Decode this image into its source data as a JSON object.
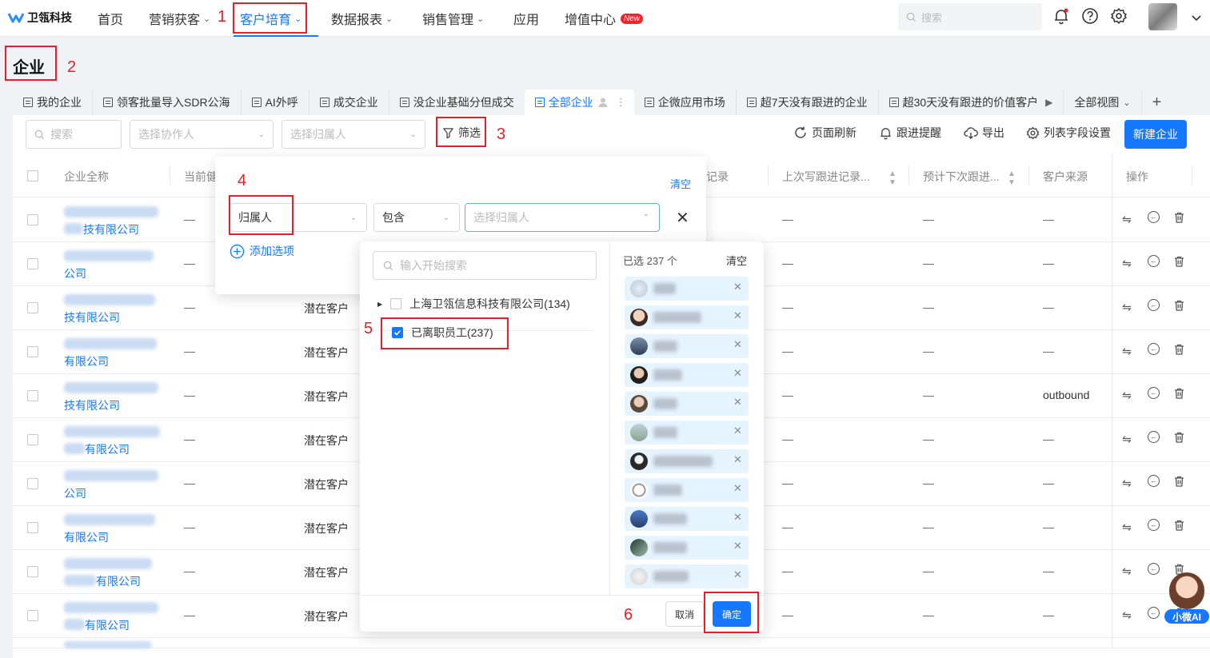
{
  "brand": {
    "name": "卫瓴科技"
  },
  "nav": {
    "items": [
      {
        "label": "首页"
      },
      {
        "label": "营销获客"
      },
      {
        "label": "客户培育"
      },
      {
        "label": "数据报表"
      },
      {
        "label": "销售管理"
      },
      {
        "label": "应用"
      },
      {
        "label": "增值中心"
      }
    ],
    "new_badge": "New",
    "search_placeholder": "搜索"
  },
  "annotations": {
    "n1": "1",
    "n2": "2",
    "n3": "3",
    "n4": "4",
    "n5": "5",
    "n6": "6"
  },
  "page": {
    "title": "企业"
  },
  "tabs": [
    {
      "label": "我的企业"
    },
    {
      "label": "领客批量导入SDR公海"
    },
    {
      "label": "AI外呼"
    },
    {
      "label": "成交企业"
    },
    {
      "label": "没企业基础分但成交"
    },
    {
      "label": "全部企业"
    },
    {
      "label": "企微应用市场"
    },
    {
      "label": "超7天没有跟进的企业"
    },
    {
      "label": "超30天没有跟进的价值客户"
    },
    {
      "label": "全部视图"
    }
  ],
  "toolbar": {
    "search_placeholder": "搜索",
    "collab_placeholder": "选择协作人",
    "owner_placeholder": "选择归属人",
    "filter_label": "筛选",
    "refresh_label": "页面刷新",
    "remind_label": "跟进提醒",
    "export_label": "导出",
    "columns_label": "列表字段设置",
    "new_label": "新建企业"
  },
  "table": {
    "headers": {
      "name": "企业全称",
      "stage": "当前健",
      "record": "记录",
      "last_write": "上次写跟进记录...",
      "next_follow": "预计下次跟进...",
      "source": "客户来源",
      "ops": "操作"
    },
    "dash": "—",
    "rows": [
      {
        "company": "技有限公司",
        "status": ""
      },
      {
        "company": "公司",
        "status": ""
      },
      {
        "company": "技有限公司",
        "status": "潜在客户"
      },
      {
        "company": "有限公司",
        "status": "潜在客户"
      },
      {
        "company": "技有限公司",
        "status": "潜在客户",
        "source": "outbound"
      },
      {
        "company": "有限公司",
        "status": "潜在客户"
      },
      {
        "company": "公司",
        "status": "潜在客户"
      },
      {
        "company": "有限公司",
        "status": "潜在客户"
      },
      {
        "company": "有限公司",
        "status": "潜在客户"
      },
      {
        "company": "有限公司",
        "status": "潜在客户"
      }
    ]
  },
  "filter": {
    "clear_label": "清空",
    "field_value": "归属人",
    "operator_value": "包含",
    "value_placeholder": "选择归属人",
    "add_option_label": "添加选项"
  },
  "owner_picker": {
    "search_placeholder": "输入开始搜索",
    "groups": [
      {
        "label": "上海卫瓴信息科技有限公司(134)",
        "checked": false
      },
      {
        "label": "已离职员工(237)",
        "checked": true
      }
    ],
    "selected_label": "已选 237 个",
    "clear_label": "清空",
    "cancel_label": "取消",
    "confirm_label": "确定"
  },
  "ai": {
    "label": "小微AI"
  },
  "colors": {
    "primary": "#1677ff",
    "annotation": "#e6202a",
    "badge": "#f5222d"
  }
}
